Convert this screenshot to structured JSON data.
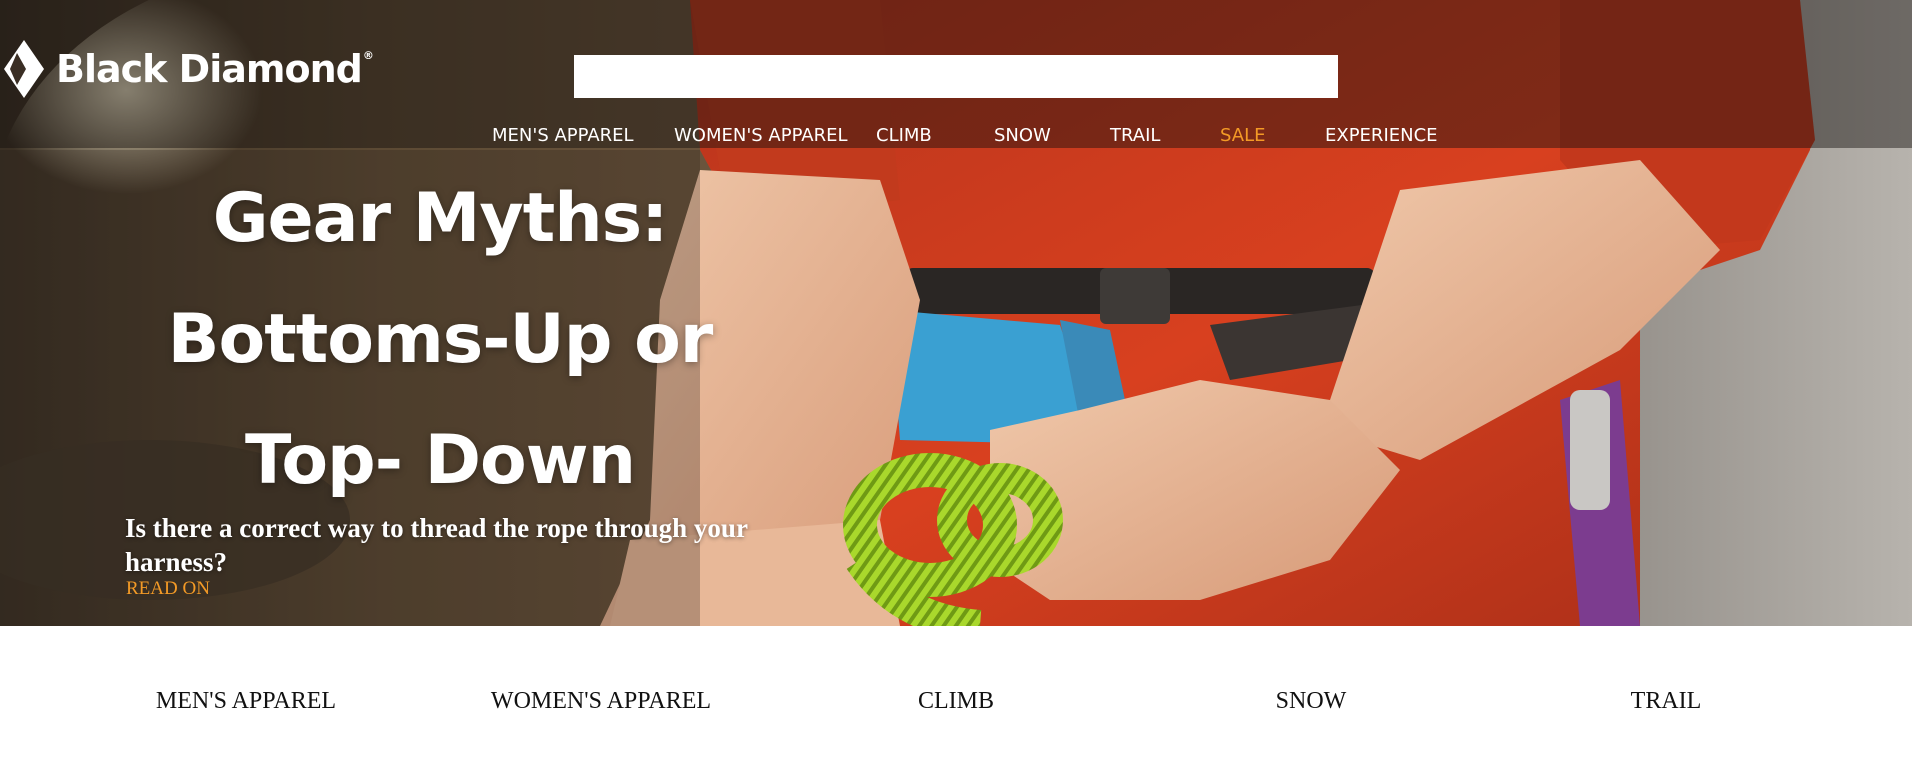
{
  "brand": {
    "name": "Black Diamond",
    "reg_mark": "®"
  },
  "search": {
    "value": "",
    "placeholder": ""
  },
  "nav": {
    "items": [
      {
        "label": "MEN'S APPAREL"
      },
      {
        "label": "WOMEN'S APPAREL"
      },
      {
        "label": "CLIMB"
      },
      {
        "label": "SNOW"
      },
      {
        "label": "TRAIL"
      },
      {
        "label": "SALE"
      },
      {
        "label": "EXPERIENCE"
      }
    ]
  },
  "hero": {
    "headline_lines": [
      "Gear Myths:",
      "Bottoms-Up or",
      "Top- Down"
    ],
    "subhead": "Is there a correct way to thread the rope through your harness?",
    "cta": "READ ON"
  },
  "categories": [
    {
      "label": "MEN'S APPAREL"
    },
    {
      "label": "WOMEN'S APPAREL"
    },
    {
      "label": "CLIMB"
    },
    {
      "label": "SNOW"
    },
    {
      "label": "TRAIL"
    }
  ],
  "colors": {
    "accent": "#f39a26",
    "nav_text": "#ffffff",
    "category_text": "#111111",
    "shirt": "#d8381c",
    "rope": "#a6d52a",
    "harness": "#3a9fd0"
  },
  "icons": {
    "logo": "black-diamond-logo-icon"
  }
}
